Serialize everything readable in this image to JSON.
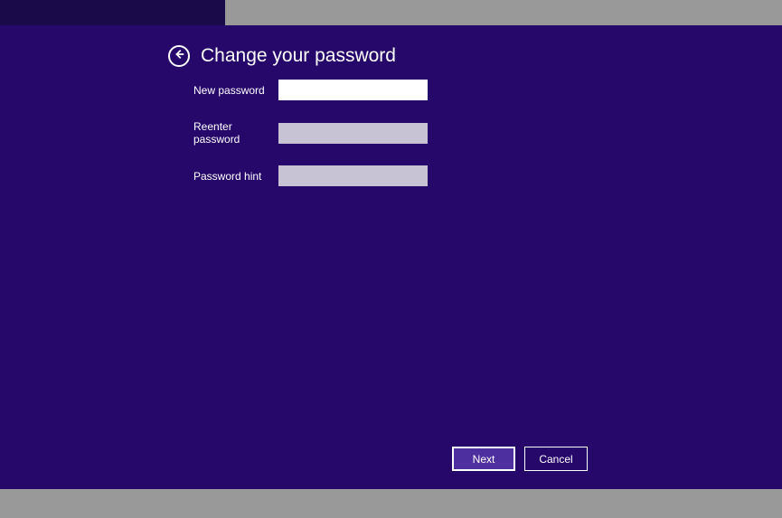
{
  "page": {
    "title": "Change your password"
  },
  "form": {
    "new_password": {
      "label": "New password",
      "value": ""
    },
    "reenter_password": {
      "label": "Reenter password",
      "value": ""
    },
    "password_hint": {
      "label": "Password hint",
      "value": ""
    }
  },
  "buttons": {
    "next": "Next",
    "cancel": "Cancel"
  }
}
